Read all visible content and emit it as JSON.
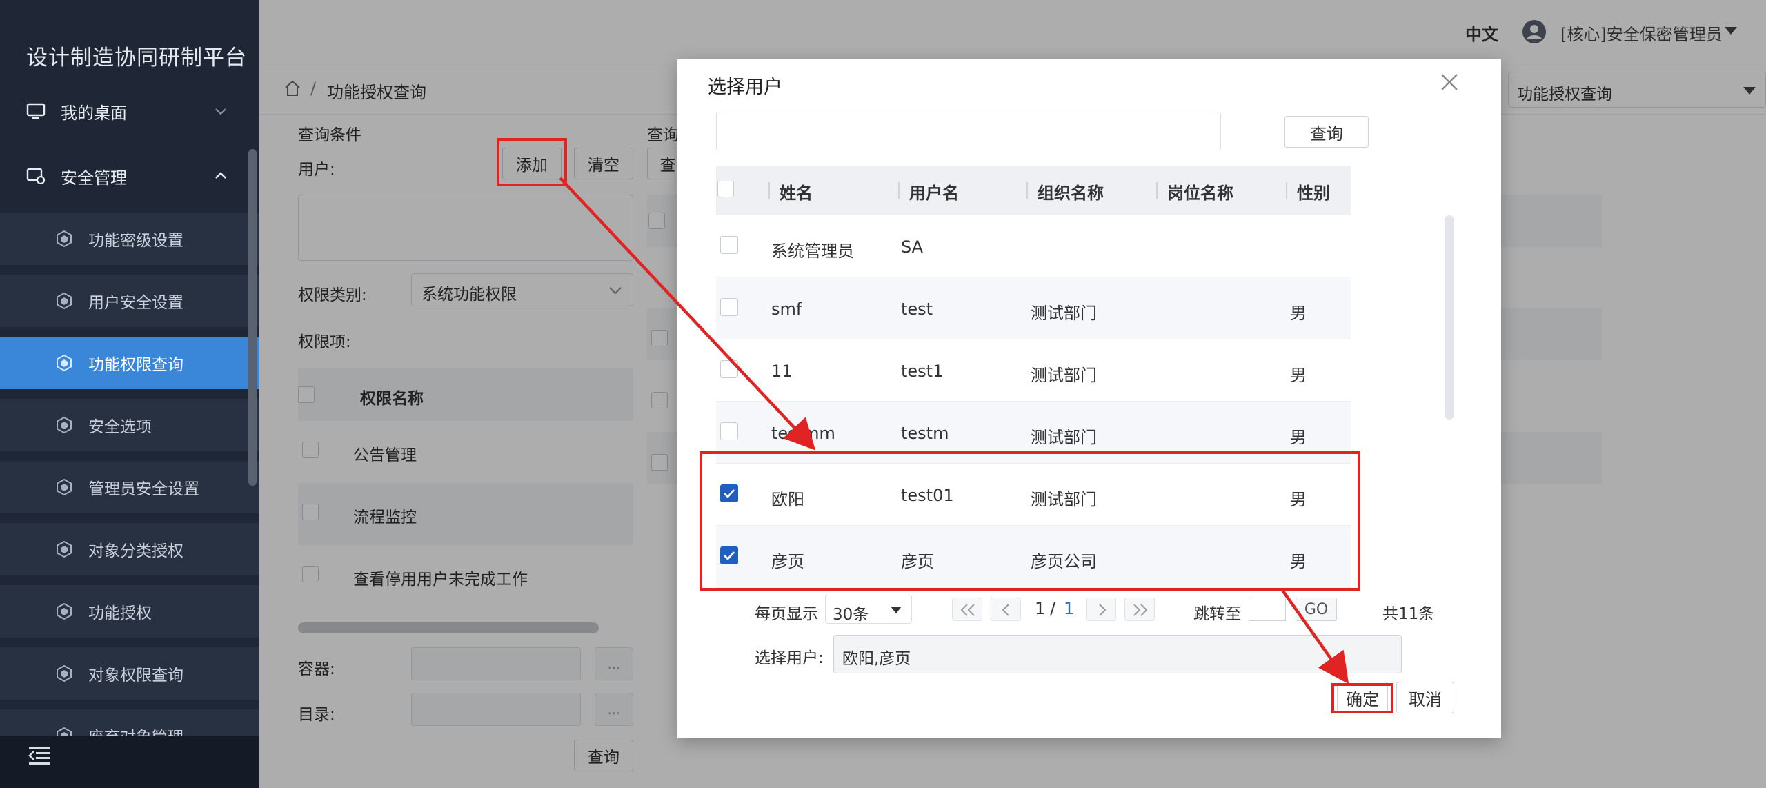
{
  "app": {
    "title": "设计制造协同研制平台"
  },
  "sidebar": {
    "groups": [
      {
        "label": "我的桌面"
      },
      {
        "label": "安全管理"
      }
    ],
    "items": [
      {
        "label": "功能密级设置"
      },
      {
        "label": "用户安全设置"
      },
      {
        "label": "功能权限查询"
      },
      {
        "label": "安全选项"
      },
      {
        "label": "管理员安全设置"
      },
      {
        "label": "对象分类授权"
      },
      {
        "label": "功能授权"
      },
      {
        "label": "对象权限查询"
      },
      {
        "label": "废弃对象管理"
      }
    ]
  },
  "header": {
    "lang": "中文",
    "user": "[核心]安全保密管理员"
  },
  "breadcrumb": {
    "sep": "/",
    "current": "功能授权查询"
  },
  "top_select": {
    "value": "功能授权查询"
  },
  "query": {
    "section_title": "查询条件",
    "user_label": "用户:",
    "add": "添加",
    "clear": "清空",
    "partial_query": "查",
    "partial_title": "查询",
    "perm_type_label": "权限类别:",
    "perm_type_value": "系统功能权限",
    "perm_items_label": "权限项:",
    "perm_name_header": "权限名称",
    "perm_rows": [
      "公告管理",
      "流程监控",
      "查看停用用户未完成工作"
    ],
    "container_label": "容器:",
    "dir_label": "目录:",
    "dots": "...",
    "query_btn": "查询"
  },
  "modal": {
    "title": "选择用户",
    "search_btn": "查询",
    "columns": [
      "姓名",
      "用户名",
      "组织名称",
      "岗位名称",
      "性别"
    ],
    "rows": [
      {
        "name": "系统管理员",
        "username": "SA",
        "org": "",
        "post": "",
        "gender": ""
      },
      {
        "name": "smf",
        "username": "test",
        "org": "测试部门",
        "post": "",
        "gender": "男"
      },
      {
        "name": "11",
        "username": "test1",
        "org": "测试部门",
        "post": "",
        "gender": "男"
      },
      {
        "name": "testmm",
        "username": "testm",
        "org": "测试部门",
        "post": "",
        "gender": "男"
      },
      {
        "name": "欧阳",
        "username": "test01",
        "org": "测试部门",
        "post": "",
        "gender": "男"
      },
      {
        "name": "彦页",
        "username": "彦页",
        "org": "彦页公司",
        "post": "",
        "gender": "男"
      }
    ],
    "pagination": {
      "per_page_label": "每页显示",
      "per_page_value": "30条",
      "current": "1",
      "sep": "/",
      "total_pages": "1",
      "jump_label": "跳转至",
      "go": "GO",
      "total": "共11条"
    },
    "selected_label": "选择用户:",
    "selected_value": "欧阳,彦页",
    "ok": "确定",
    "cancel": "取消"
  },
  "colors": {
    "sidebar_bg": "#1f2736",
    "active": "#3a86d8",
    "check_on": "#1f5fbf",
    "annotation": "#e02424"
  }
}
